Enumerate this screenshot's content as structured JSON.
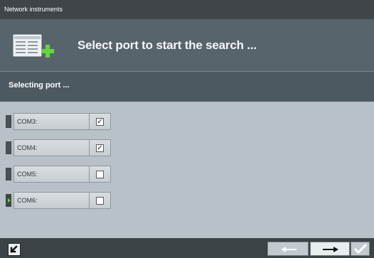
{
  "window": {
    "title": "Network instruments"
  },
  "header": {
    "title": "Select port to start the search ...",
    "icon": "network-plus-icon"
  },
  "section": {
    "title": "Selecting port ..."
  },
  "ports": [
    {
      "label": "COM3:",
      "checked": true,
      "indicator": "inactive"
    },
    {
      "label": "COM4:",
      "checked": true,
      "indicator": "inactive"
    },
    {
      "label": "COM5:",
      "checked": false,
      "indicator": "inactive"
    },
    {
      "label": "COM6:",
      "checked": false,
      "indicator": "active"
    }
  ],
  "footer": {
    "up_icon": "up-left-arrow-icon",
    "back_icon": "left-arrow-icon",
    "next_icon": "right-arrow-icon",
    "finish_icon": "check-icon"
  },
  "colors": {
    "accent": "#67d63e",
    "header": "#58646b",
    "panel": "#b7c1c7"
  }
}
